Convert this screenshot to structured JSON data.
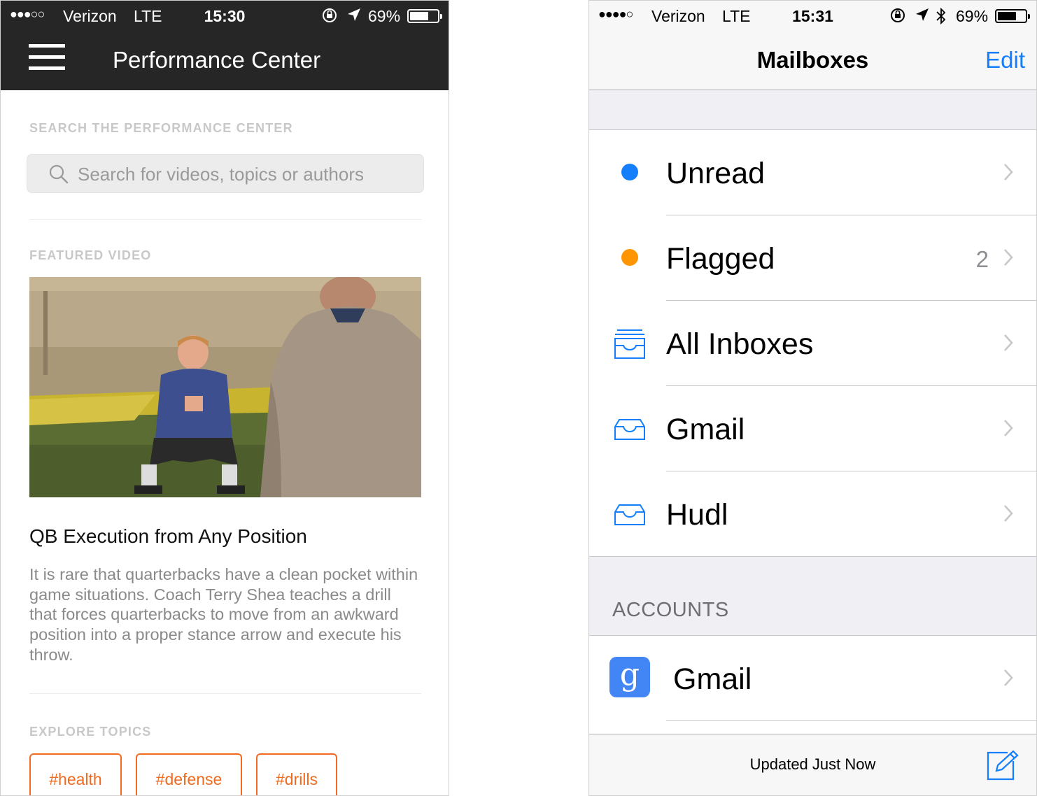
{
  "left_screen": {
    "status_bar": {
      "signal": "●●●○○",
      "carrier": "Verizon",
      "network": "LTE",
      "time": "15:30",
      "battery": "69%",
      "battery_level": 0.69
    },
    "header": {
      "title": "Performance Center",
      "menu_icon": "hamburger-menu-icon"
    },
    "search": {
      "section_label": "SEARCH THE PERFORMANCE CENTER",
      "placeholder": "Search for videos, topics or authors"
    },
    "featured": {
      "section_label": "FEATURED VIDEO",
      "title": "QB Execution from Any Position",
      "description": "It is rare that quarterbacks have a clean pocket within game situations. Coach Terry Shea teaches a drill that forces quarterbacks to move from an awkward position into a proper stance arrow and execute his throw."
    },
    "topics": {
      "section_label": "EXPLORE TOPICS",
      "tags": [
        "#health",
        "#defense",
        "#drills"
      ]
    },
    "colors": {
      "header_bg": "#262626",
      "accent": "#f06a1f"
    }
  },
  "right_screen": {
    "status_bar": {
      "signal": "●●●●○",
      "carrier": "Verizon",
      "network": "LTE",
      "time": "15:31",
      "battery": "69%",
      "battery_level": 0.69
    },
    "nav": {
      "title": "Mailboxes",
      "edit_label": "Edit"
    },
    "mailboxes": [
      {
        "label": "Unread",
        "icon": "blue-dot-icon",
        "count": ""
      },
      {
        "label": "Flagged",
        "icon": "orange-dot-icon",
        "count": "2"
      },
      {
        "label": "All Inboxes",
        "icon": "all-inboxes-tray-icon",
        "count": ""
      },
      {
        "label": "Gmail",
        "icon": "inbox-tray-icon",
        "count": ""
      },
      {
        "label": "Hudl",
        "icon": "inbox-tray-icon",
        "count": ""
      }
    ],
    "accounts": {
      "section_label": "ACCOUNTS",
      "items": [
        {
          "label": "Gmail",
          "icon": "google-g-icon",
          "icon_text": "g"
        }
      ]
    },
    "toolbar": {
      "status": "Updated Just Now",
      "compose_icon": "compose-icon"
    },
    "colors": {
      "tint": "#147efb",
      "unread_dot": "#147efb",
      "flag_dot": "#ff9500",
      "google": "#4285f4"
    }
  }
}
